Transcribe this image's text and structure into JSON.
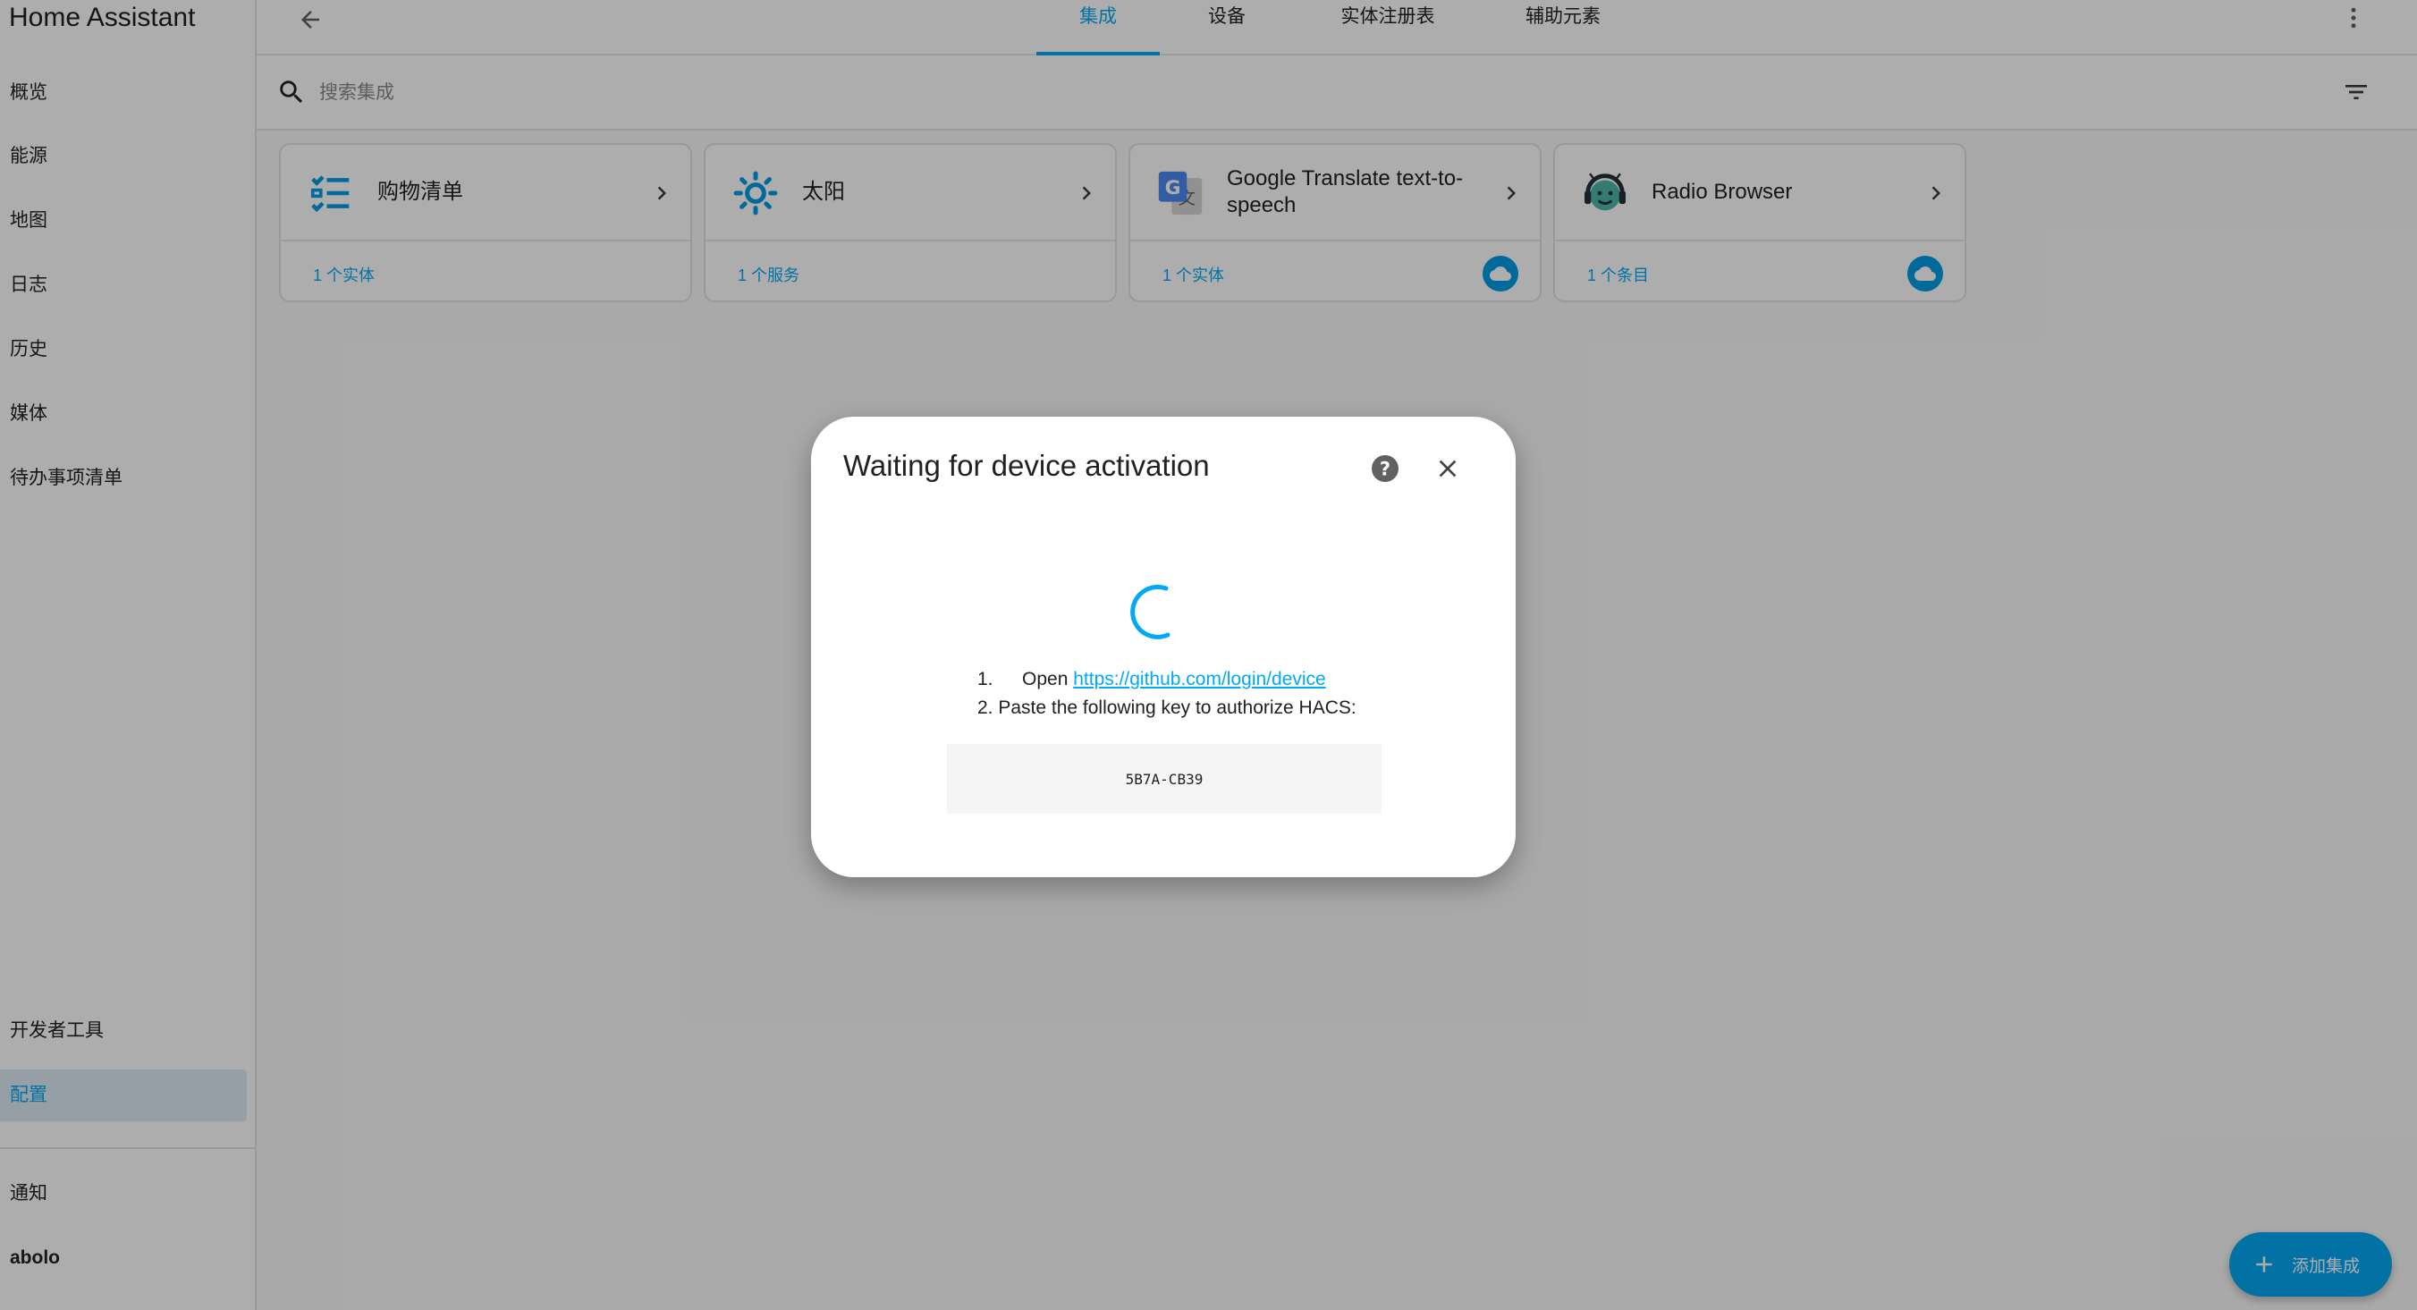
{
  "app": {
    "title": "Home Assistant"
  },
  "sidebar": {
    "items": [
      {
        "label": "概览"
      },
      {
        "label": "能源"
      },
      {
        "label": "地图"
      },
      {
        "label": "日志"
      },
      {
        "label": "历史"
      },
      {
        "label": "媒体"
      },
      {
        "label": "待办事项清单"
      }
    ],
    "bottom_items": [
      {
        "label": "开发者工具"
      },
      {
        "label": "配置",
        "active": true
      }
    ],
    "notifications_label": "通知",
    "user_label": "abolo"
  },
  "header": {
    "tabs": [
      {
        "label": "集成",
        "active": true
      },
      {
        "label": "设备"
      },
      {
        "label": "实体注册表"
      },
      {
        "label": "辅助元素"
      }
    ]
  },
  "search": {
    "placeholder": "搜索集成",
    "value": ""
  },
  "integrations": [
    {
      "title": "购物清单",
      "link": "1 个实体",
      "icon": "shopping-list-icon",
      "cloud": false
    },
    {
      "title": "太阳",
      "link": "1 个服务",
      "icon": "sun-icon",
      "cloud": false
    },
    {
      "title": "Google Translate text-to-speech",
      "link": "1 个实体",
      "icon": "google-translate-icon",
      "cloud": true
    },
    {
      "title": "Radio Browser",
      "link": "1 个条目",
      "icon": "radio-browser-icon",
      "cloud": true
    }
  ],
  "fab": {
    "label": "添加集成"
  },
  "dialog": {
    "title": "Waiting for device activation",
    "steps": {
      "step1_number": "1.",
      "step1_prefix": "Open",
      "step1_link": "https://github.com/login/device",
      "step2": "2. Paste the following key to authorize HACS:"
    },
    "code": "5B7A-CB39"
  },
  "colors": {
    "accent": "#03a9f4",
    "cloud_badge": "#039be5",
    "overlay": "rgba(0,0,0,0.32)"
  }
}
